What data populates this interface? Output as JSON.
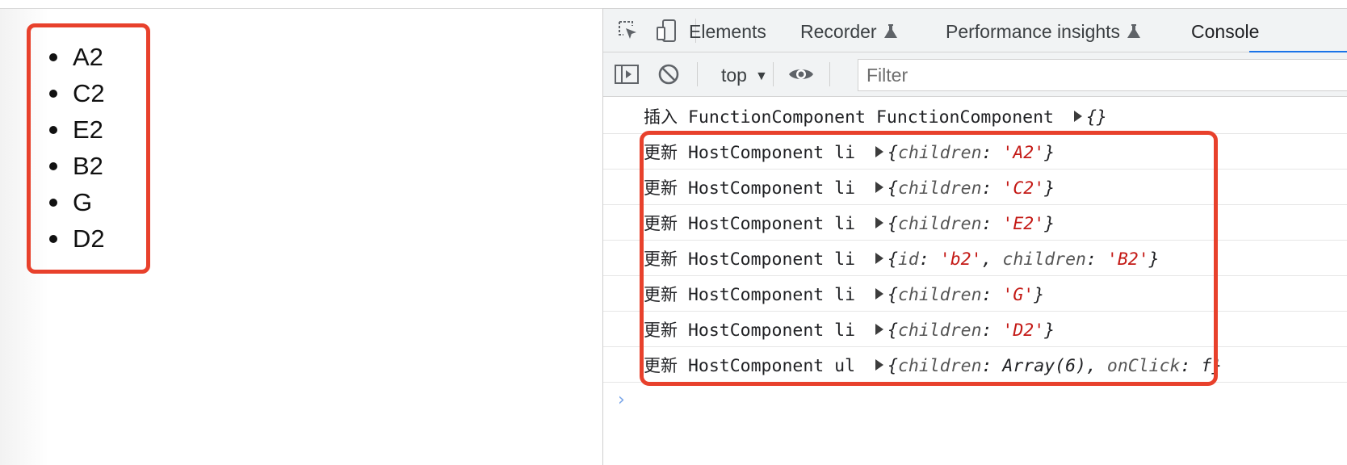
{
  "page": {
    "list_items": [
      "A2",
      "C2",
      "E2",
      "B2",
      "G",
      "D2"
    ]
  },
  "devtools": {
    "tabs": [
      {
        "label": "Elements",
        "flask": false
      },
      {
        "label": "Recorder",
        "flask": true
      },
      {
        "label": "Performance insights",
        "flask": true
      },
      {
        "label": "Console",
        "flask": false
      }
    ],
    "active_tab": "Console",
    "context": "top",
    "filter_placeholder": "Filter",
    "icons": [
      "inspect-element-icon",
      "device-toolbar-icon",
      "sidebar-toggle-icon",
      "clear-console-icon",
      "live-expression-eye-icon"
    ],
    "accent_color": "#1a73e8"
  },
  "console": {
    "first_line": {
      "action": "插入",
      "text": "FunctionComponent FunctionComponent",
      "obj": "{}"
    },
    "logs": [
      {
        "action": "更新",
        "tag": "HostComponent li",
        "props": [
          {
            "k": "children",
            "v": "'A2'"
          }
        ]
      },
      {
        "action": "更新",
        "tag": "HostComponent li",
        "props": [
          {
            "k": "children",
            "v": "'C2'"
          }
        ]
      },
      {
        "action": "更新",
        "tag": "HostComponent li",
        "props": [
          {
            "k": "children",
            "v": "'E2'"
          }
        ]
      },
      {
        "action": "更新",
        "tag": "HostComponent li",
        "props": [
          {
            "k": "id",
            "v": "'b2'"
          },
          {
            "k": "children",
            "v": "'B2'"
          }
        ]
      },
      {
        "action": "更新",
        "tag": "HostComponent li",
        "props": [
          {
            "k": "children",
            "v": "'G'"
          }
        ]
      },
      {
        "action": "更新",
        "tag": "HostComponent li",
        "props": [
          {
            "k": "children",
            "v": "'D2'"
          }
        ]
      },
      {
        "action": "更新",
        "tag": "HostComponent ul",
        "props": [
          {
            "k": "children",
            "v": "Array(6)",
            "plain": true
          },
          {
            "k": "onClick",
            "v": "f",
            "plain": true
          }
        ]
      }
    ],
    "prompt": "›"
  },
  "highlight_color": "#e8412c"
}
